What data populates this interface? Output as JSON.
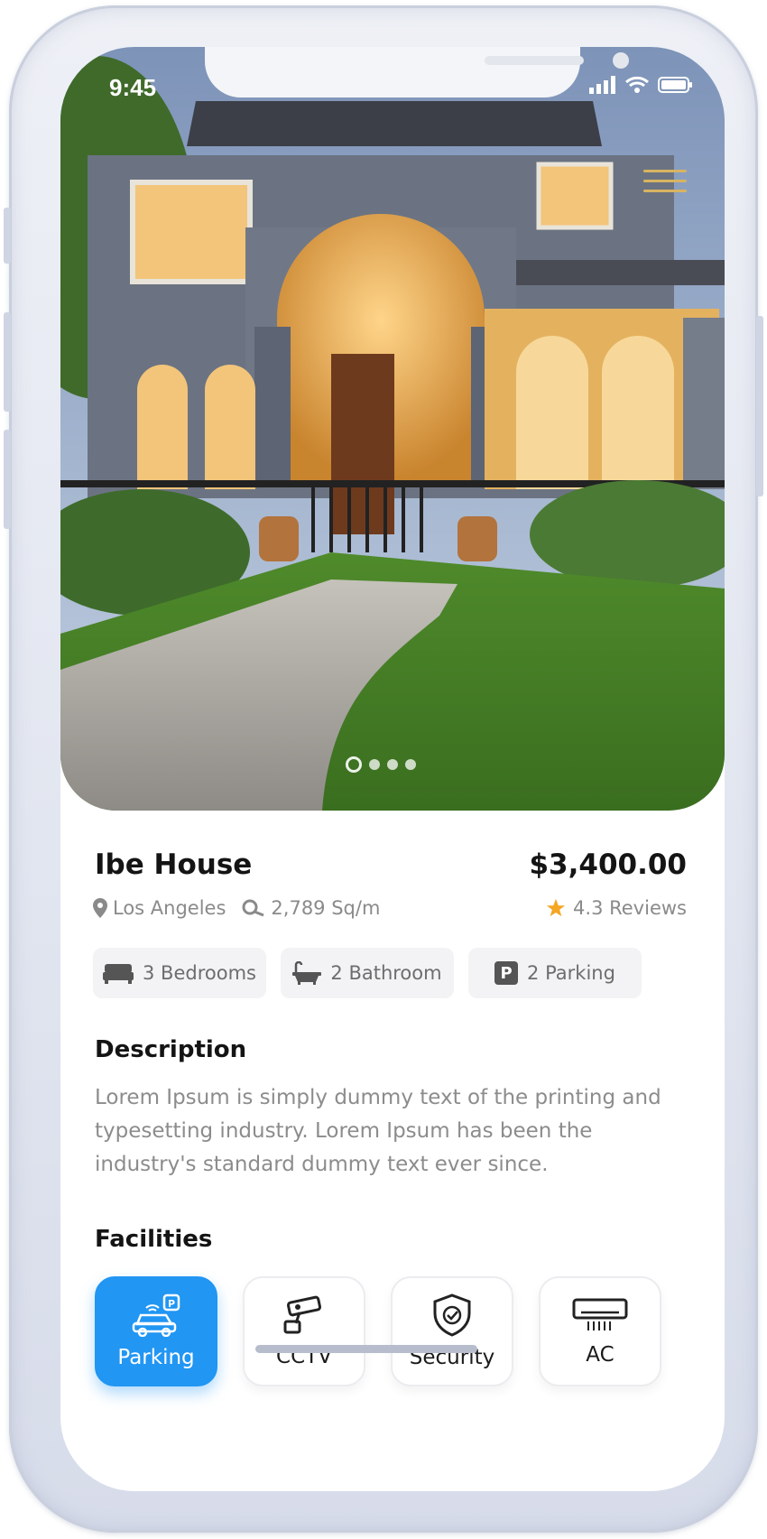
{
  "status": {
    "time": "9:45"
  },
  "property": {
    "name": "Ibe House",
    "price": "$3,400.00",
    "location": "Los Angeles",
    "area": "2,789 Sq/m",
    "rating": "4.3 Reviews",
    "rating_color": "#f5a623"
  },
  "carousel": {
    "count": 4,
    "active_index": 0
  },
  "features": [
    {
      "icon": "bed-icon",
      "label": "3 Bedrooms"
    },
    {
      "icon": "bathtub-icon",
      "label": "2 Bathroom"
    },
    {
      "icon": "parking-sign-icon",
      "badge": "P",
      "label": "2 Parking"
    }
  ],
  "description": {
    "heading": "Description",
    "text": "Lorem Ipsum is simply dummy text of the printing and typesetting industry. Lorem Ipsum has been the industry's standard dummy text ever since."
  },
  "facilities": {
    "heading": "Facilities",
    "items": [
      {
        "icon": "parking-car-icon",
        "label": "Parking",
        "selected": true
      },
      {
        "icon": "cctv-camera-icon",
        "label": "CCTV",
        "selected": false
      },
      {
        "icon": "security-shield-icon",
        "label": "Security",
        "selected": false
      },
      {
        "icon": "air-conditioner-icon",
        "label": "AC",
        "selected": false
      }
    ]
  },
  "colors": {
    "accent": "#2196f3",
    "title": "#141414",
    "muted": "#8a8a8a"
  }
}
